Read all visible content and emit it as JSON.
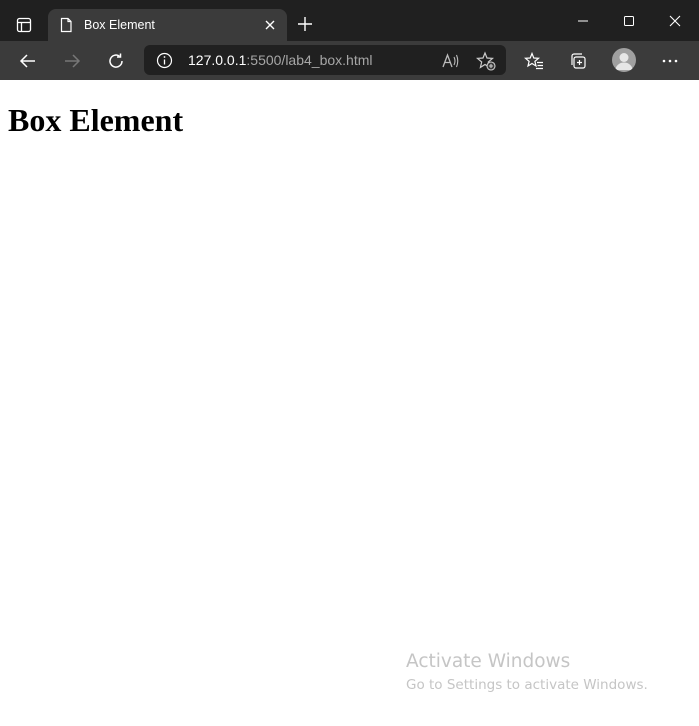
{
  "browser": {
    "tab": {
      "title": "Box Element"
    },
    "address_bar": {
      "host": "127.0.0.1",
      "path": ":5500/lab4_box.html"
    },
    "icons": [
      "tab-actions-icon",
      "page-icon",
      "close-icon",
      "plus-icon",
      "minimize-icon",
      "maximize-icon",
      "close-window-icon",
      "back-arrow-icon",
      "forward-arrow-icon",
      "refresh-icon",
      "info-icon",
      "read-aloud-icon",
      "add-favorite-icon",
      "favorites-icon",
      "collections-icon",
      "profile-icon",
      "more-icon"
    ],
    "colors": {
      "tabbar_bg": "#202020",
      "toolbar_bg": "#3b3b3b",
      "address_bg": "#202020"
    }
  },
  "page": {
    "heading": "Box Element"
  },
  "watermark": {
    "title": "Activate Windows",
    "subtitle": "Go to Settings to activate Windows."
  }
}
